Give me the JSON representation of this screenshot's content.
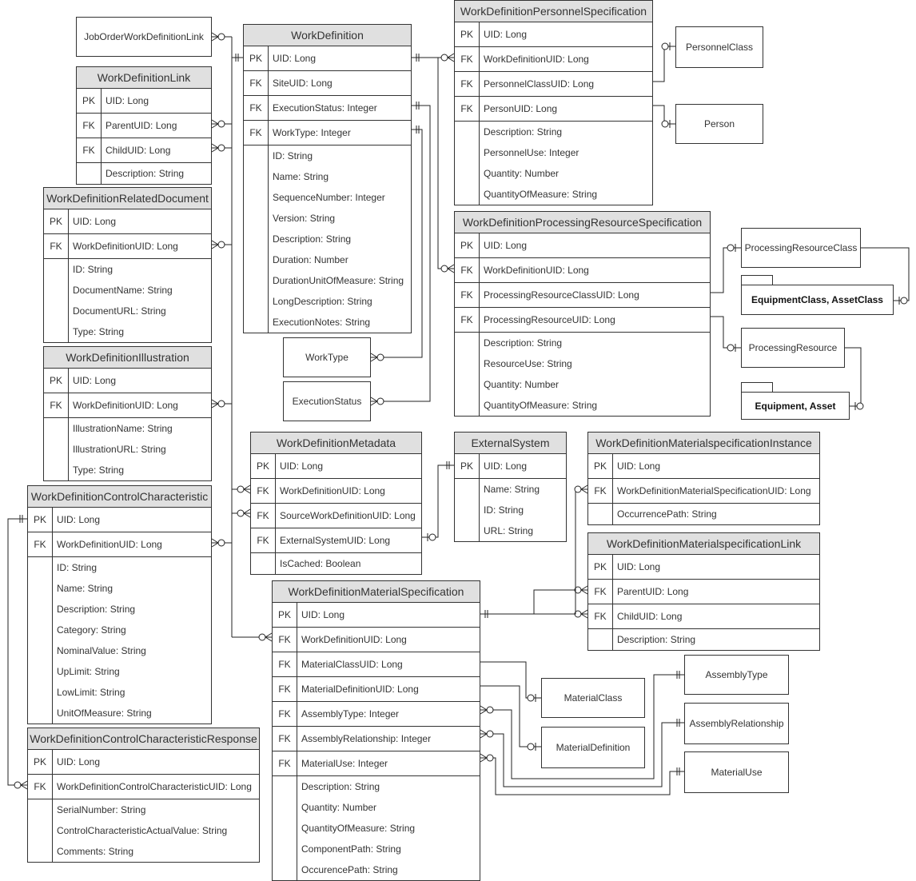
{
  "tables": {
    "wd": {
      "name": "WorkDefinition",
      "rows": [
        [
          "PK",
          "UID: Long"
        ],
        [
          "FK",
          "SiteUID: Long"
        ],
        [
          "FK",
          "ExecutionStatus: Integer"
        ],
        [
          "FK",
          "WorkType: Integer"
        ]
      ],
      "attrs": [
        "ID: String",
        "Name: String",
        "SequenceNumber: Integer",
        "Version: String",
        "Description: String",
        "Duration: Number",
        "DurationUnitOfMeasure: String",
        "LongDescription: String",
        "ExecutionNotes: String"
      ]
    },
    "wdl": {
      "name": "WorkDefinitionLink",
      "rows": [
        [
          "PK",
          "UID: Long"
        ],
        [
          "FK",
          "ParentUID: Long"
        ],
        [
          "FK",
          "ChildUID: Long"
        ]
      ],
      "attrs": [
        "Description: String"
      ]
    },
    "wdrd": {
      "name": "WorkDefinitionRelatedDocument",
      "rows": [
        [
          "PK",
          "UID: Long"
        ],
        [
          "FK",
          "WorkDefinitionUID: Long"
        ]
      ],
      "attrs": [
        "ID: String",
        "DocumentName: String",
        "DocumentURL: String",
        "Type: String"
      ]
    },
    "wdi": {
      "name": "WorkDefinitionIllustration",
      "rows": [
        [
          "PK",
          "UID: Long"
        ],
        [
          "FK",
          "WorkDefinitionUID: Long"
        ]
      ],
      "attrs": [
        "IllustrationName: String",
        "IllustrationURL: String",
        "Type: String"
      ]
    },
    "wdcc": {
      "name": "WorkDefinitionControlCharacteristic",
      "rows": [
        [
          "PK",
          "UID: Long"
        ],
        [
          "FK",
          "WorkDefinitionUID: Long"
        ]
      ],
      "attrs": [
        "ID: String",
        "Name: String",
        "Description: String",
        "Category: String",
        "NominalValue: String",
        "UpLimit: String",
        "LowLimit: String",
        "UnitOfMeasure: String"
      ]
    },
    "wdccr": {
      "name": "WorkDefinitionControlCharacteristicResponse",
      "rows": [
        [
          "PK",
          "UID: Long"
        ],
        [
          "FK",
          "WorkDefinitionControlCharacteristicUID: Long"
        ]
      ],
      "attrs": [
        "SerialNumber: String",
        "ControlCharacteristicActualValue: String",
        "Comments: String"
      ]
    },
    "wdps": {
      "name": "WorkDefinitionPersonnelSpecification",
      "rows": [
        [
          "PK",
          "UID: Long"
        ],
        [
          "FK",
          "WorkDefinitionUID: Long"
        ],
        [
          "FK",
          "PersonnelClassUID: Long"
        ],
        [
          "FK",
          "PersonUID: Long"
        ]
      ],
      "attrs": [
        "Description: String",
        "PersonnelUse: Integer",
        "Quantity: Number",
        "QuantityOfMeasure: String"
      ]
    },
    "wdprs": {
      "name": "WorkDefinitionProcessingResourceSpecification",
      "rows": [
        [
          "PK",
          "UID: Long"
        ],
        [
          "FK",
          "WorkDefinitionUID: Long"
        ],
        [
          "FK",
          "ProcessingResourceClassUID: Long"
        ],
        [
          "FK",
          "ProcessingResourceUID: Long"
        ]
      ],
      "attrs": [
        "Description: String",
        "ResourceUse: String",
        "Quantity: Number",
        "QuantityOfMeasure: String"
      ]
    },
    "wdm": {
      "name": "WorkDefinitionMetadata",
      "rows": [
        [
          "PK",
          "UID: Long"
        ],
        [
          "FK",
          "WorkDefinitionUID: Long"
        ],
        [
          "FK",
          "SourceWorkDefinitionUID: Long"
        ],
        [
          "FK",
          "ExternalSystemUID: Long"
        ]
      ],
      "attrs": [
        "IsCached: Boolean"
      ]
    },
    "es": {
      "name": "ExternalSystem",
      "rows": [
        [
          "PK",
          "UID: Long"
        ]
      ],
      "attrs": [
        "Name: String",
        "ID: String",
        "URL: String"
      ]
    },
    "wdmsi": {
      "name": "WorkDefinitionMaterialspecificationInstance",
      "rows": [
        [
          "PK",
          "UID: Long"
        ],
        [
          "FK",
          "WorkDefinitionMaterialSpecificationUID: Long"
        ]
      ],
      "attrs": [
        "OccurrencePath: String"
      ]
    },
    "wdmsl": {
      "name": "WorkDefinitionMaterialspecificationLink",
      "rows": [
        [
          "PK",
          "UID: Long"
        ],
        [
          "FK",
          "ParentUID: Long"
        ],
        [
          "FK",
          "ChildUID: Long"
        ]
      ],
      "attrs": [
        "Description: String"
      ]
    },
    "wdms": {
      "name": "WorkDefinitionMaterialSpecification",
      "rows": [
        [
          "PK",
          "UID: Long"
        ],
        [
          "FK",
          "WorkDefinitionUID: Long"
        ],
        [
          "FK",
          "MaterialClassUID: Long"
        ],
        [
          "FK",
          "MaterialDefinitionUID: Long"
        ],
        [
          "FK",
          "AssemblyType: Integer"
        ],
        [
          "FK",
          "AssemblyRelationship: Integer"
        ],
        [
          "FK",
          "MaterialUse: Integer"
        ]
      ],
      "attrs": [
        "Description: String",
        "Quantity: Number",
        "QuantityOfMeasure: String",
        "ComponentPath: String",
        "OccurencePath: String"
      ]
    }
  },
  "boxes": {
    "jowdl": "JobOrderWorkDefinitionLink",
    "pc": "PersonnelClass",
    "person": "Person",
    "prc": "ProcessingResourceClass",
    "pr": "ProcessingResource",
    "worktype": "WorkType",
    "execstatus": "ExecutionStatus",
    "mc": "MaterialClass",
    "md": "MaterialDefinition",
    "at": "AssemblyType",
    "ar": "AssemblyRelationship",
    "mu": "MaterialUse"
  },
  "folders": {
    "eqclass": "EquipmentClass, AssetClass",
    "eq": "Equipment, Asset"
  }
}
